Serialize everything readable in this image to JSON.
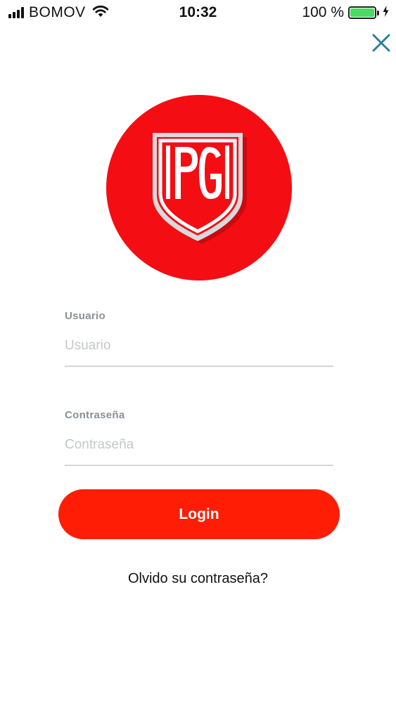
{
  "status_bar": {
    "carrier": "BOMOV",
    "time": "10:32",
    "battery_percent": "100 %",
    "battery_level": 1.0,
    "battery_color": "#4cd964"
  },
  "header": {
    "close_icon": "close-icon",
    "close_color": "#2e7f95"
  },
  "logo": {
    "text": "PG",
    "circle_color": "#f50d14"
  },
  "form": {
    "username": {
      "label": "Usuario",
      "placeholder": "Usuario",
      "value": ""
    },
    "password": {
      "label": "Contraseña",
      "placeholder": "Contraseña",
      "value": ""
    },
    "login_label": "Login",
    "login_color": "#ff1d05",
    "forgot_label": "Olvido su contraseña?"
  }
}
